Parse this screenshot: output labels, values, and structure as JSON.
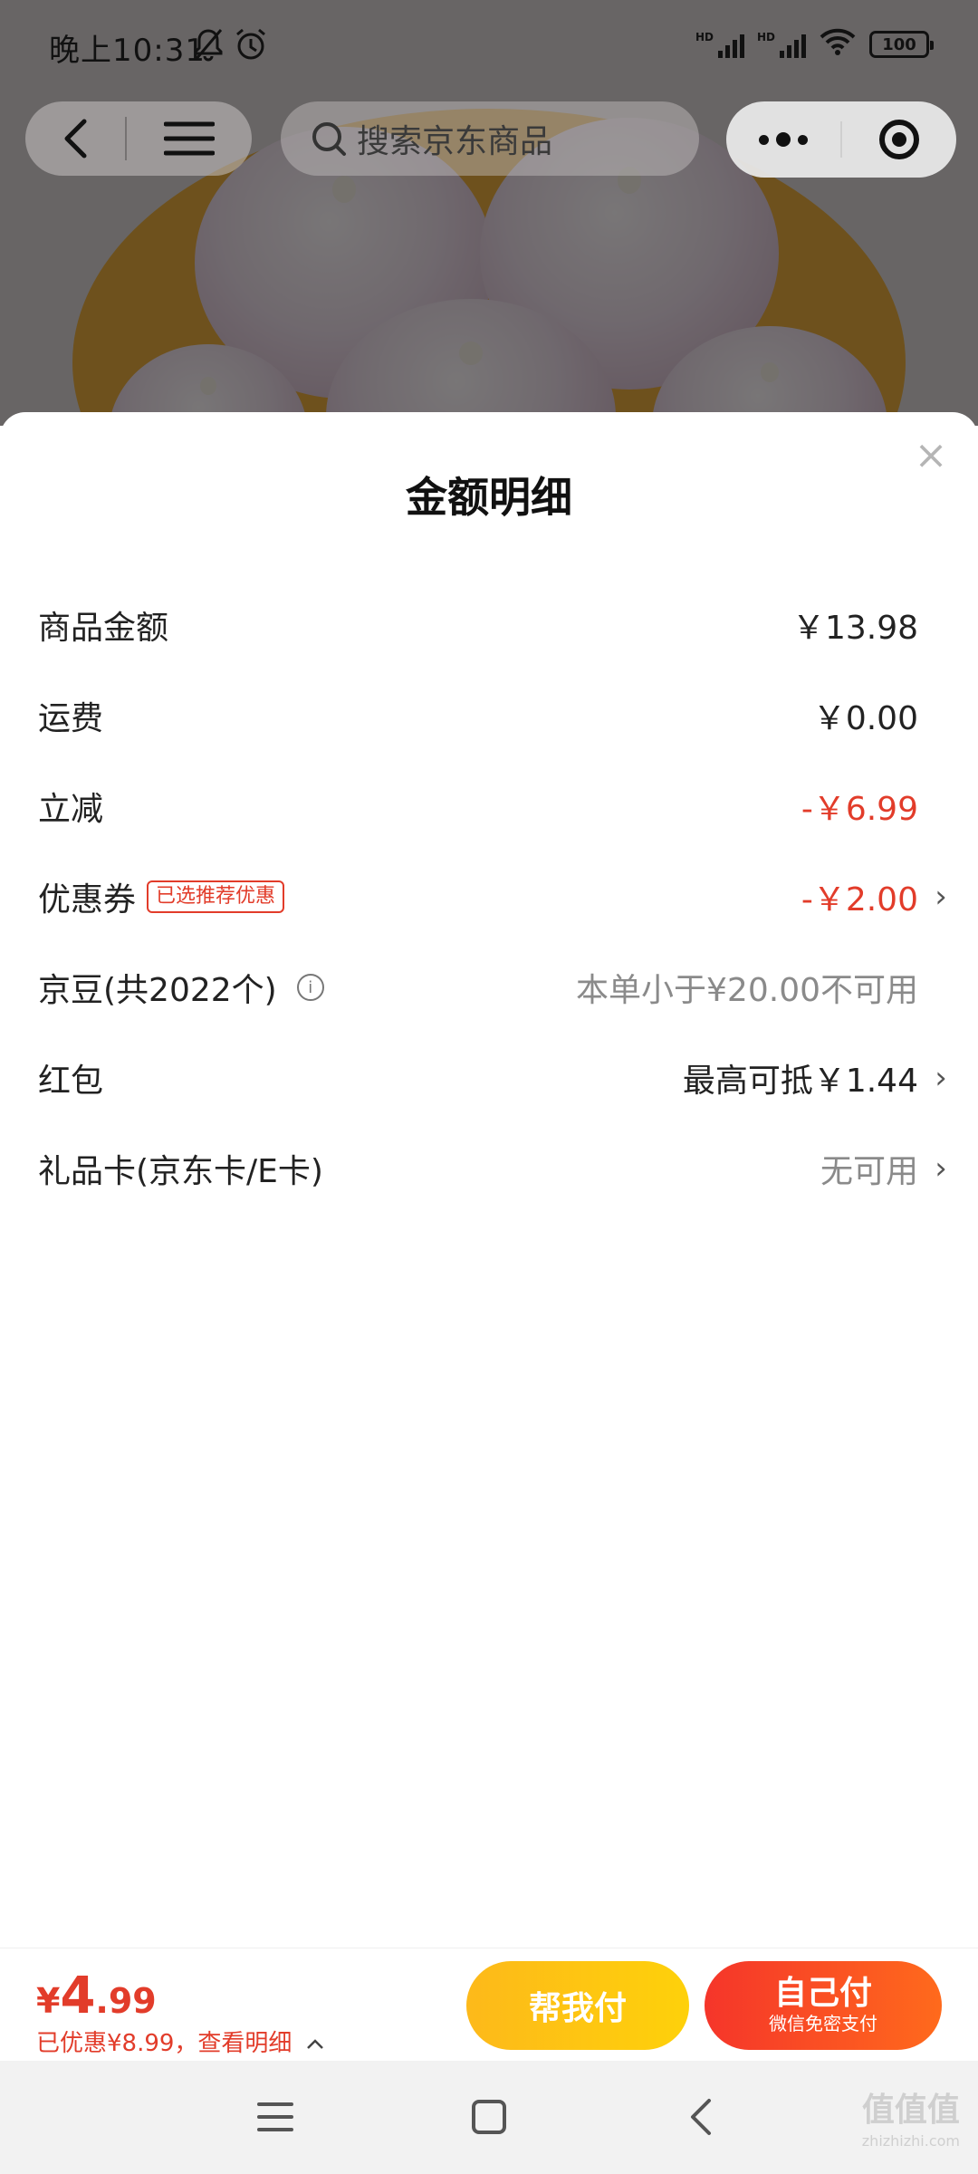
{
  "status_bar": {
    "time": "晚上10:31",
    "signal1_label": "HD",
    "signal2_label": "HD",
    "battery": "100"
  },
  "top_nav": {
    "search_placeholder": "搜索京东商品"
  },
  "sheet": {
    "title": "金额明细",
    "rows": [
      {
        "label": "商品金额",
        "value": "￥13.98"
      },
      {
        "label": "运费",
        "value": "￥0.00"
      },
      {
        "label": "立减",
        "value": "-￥6.99"
      },
      {
        "label": "优惠券",
        "tag": "已选推荐优惠",
        "value": "-￥2.00"
      },
      {
        "label": "京豆(共2022个)",
        "value": "本单小于¥20.00不可用"
      },
      {
        "label": "红包",
        "value": "最高可抵￥1.44"
      },
      {
        "label": "礼品卡(京东卡/E卡)",
        "value": "无可用"
      }
    ]
  },
  "pay_bar": {
    "currency": "¥",
    "total_int": "4",
    "total_dec": ".99",
    "saved_text": "已优惠¥8.99，查看明细",
    "help_pay_label": "帮我付",
    "self_pay_label": "自己付",
    "self_pay_sub": "微信免密支付"
  },
  "watermark": {
    "text": "值值值",
    "url": "zhizhizhi.com"
  },
  "colors": {
    "accent_red": "#e23c2a",
    "help_button": "#fdb91a",
    "self_button": "#f5352a"
  }
}
